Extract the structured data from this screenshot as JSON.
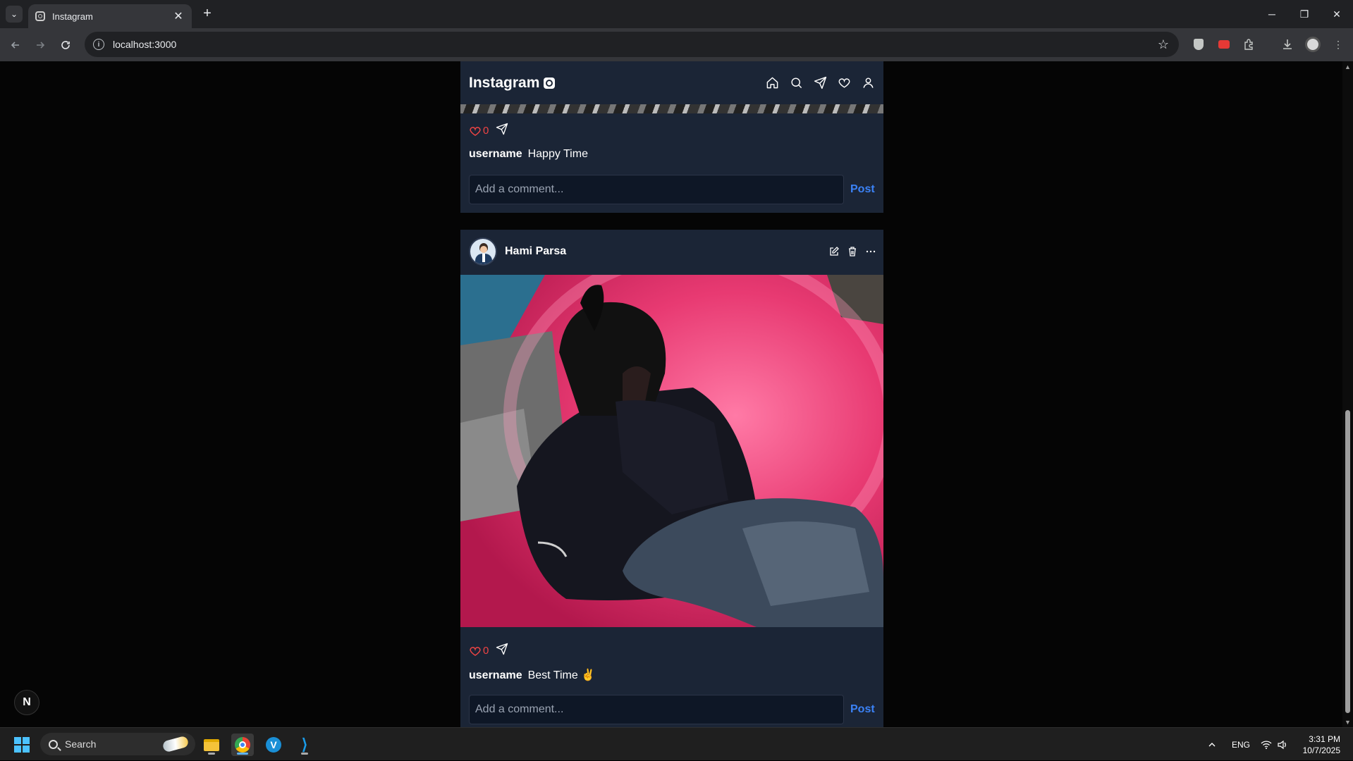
{
  "browser": {
    "tab_title": "Instagram",
    "tab_close": "✕",
    "new_tab": "+",
    "url": "localhost:3000",
    "window_controls": {
      "minimize": "─",
      "restore": "❐",
      "close": "✕"
    }
  },
  "header": {
    "logo": "Instagram",
    "nav_icons": [
      "home-icon",
      "search-icon",
      "send-icon",
      "heart-icon",
      "user-icon"
    ]
  },
  "posts": [
    {
      "likes": "0",
      "username": "username",
      "caption": "Happy Time",
      "comment_placeholder": "Add a comment...",
      "post_label": "Post"
    },
    {
      "author": "Hami Parsa",
      "likes": "0",
      "username": "username",
      "caption": "Best Time ✌",
      "comment_placeholder": "Add a comment...",
      "post_label": "Post"
    }
  ],
  "next_badge": "N",
  "taskbar": {
    "search_label": "Search",
    "language": "ENG",
    "time": "3:31 PM",
    "date": "10/7/2025"
  },
  "colors": {
    "card_bg": "#1b2536",
    "like_red": "#ef4444",
    "post_blue": "#3b82f6"
  }
}
